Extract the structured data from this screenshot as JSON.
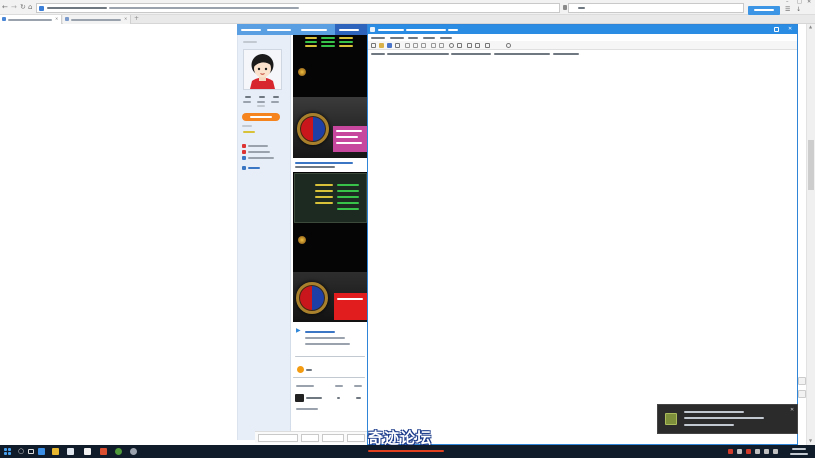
{
  "colors": {
    "browser_toolbar": "#f2f2f2",
    "browser_button": "#3d95e6",
    "forum_header": "#5b9fe3",
    "forum_sidebar": "#e7eef7",
    "orange_button": "#f5841f",
    "notepad_titlebar": "#2b8ce3",
    "notepad_border": "#2f86d8",
    "pink_panel": "#c8479e",
    "red_panel": "#e21d1d",
    "taskbar": "#111c2a",
    "toast": "#2b2b2b"
  },
  "icons": [
    "back-icon",
    "forward-icon",
    "refresh-icon",
    "home-icon",
    "search-icon",
    "minimize-icon",
    "maximize-icon",
    "close-icon",
    "avatar",
    "orb-icon",
    "coin-icon",
    "windows-start-icon",
    "task-view-icon",
    "notification-icon"
  ],
  "watermark": {
    "title": "奇迹论坛"
  }
}
